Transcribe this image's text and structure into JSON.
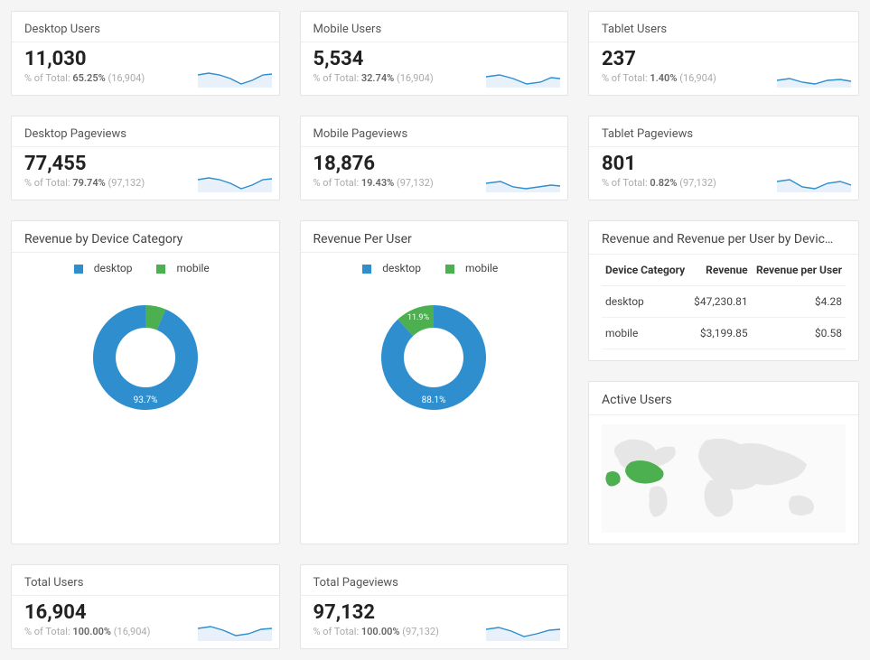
{
  "colors": {
    "blue": "#2e8ece",
    "green": "#4caf50",
    "spark_fill": "#e8f1fa",
    "spark_line": "#2e8ece",
    "map_land": "#e6e6e6",
    "map_highlight": "#4caf50",
    "map_bg": "#fafafa"
  },
  "scorecards": [
    {
      "title": "Desktop Users",
      "value": "11,030",
      "pct": "65.25%",
      "total": "(16,904)"
    },
    {
      "title": "Mobile Users",
      "value": "5,534",
      "pct": "32.74%",
      "total": "(16,904)"
    },
    {
      "title": "Tablet Users",
      "value": "237",
      "pct": "1.40%",
      "total": "(16,904)"
    },
    {
      "title": "Desktop Pageviews",
      "value": "77,455",
      "pct": "79.74%",
      "total": "(97,132)"
    },
    {
      "title": "Mobile Pageviews",
      "value": "18,876",
      "pct": "19.43%",
      "total": "(97,132)"
    },
    {
      "title": "Tablet Pageviews",
      "value": "801",
      "pct": "0.82%",
      "total": "(97,132)"
    }
  ],
  "totals": [
    {
      "title": "Total Users",
      "value": "16,904",
      "pct": "100.00%",
      "total": "(16,904)"
    },
    {
      "title": "Total Pageviews",
      "value": "97,132",
      "pct": "100.00%",
      "total": "(97,132)"
    }
  ],
  "donut1": {
    "title": "Revenue by Device Category",
    "legend": [
      "desktop",
      "mobile"
    ],
    "slices": [
      {
        "label": "desktop",
        "pct": 93.7,
        "color_key": "blue"
      },
      {
        "label": "mobile",
        "pct": 6.3,
        "color_key": "green"
      }
    ],
    "label_shown": "93.7%"
  },
  "donut2": {
    "title": "Revenue Per User",
    "legend": [
      "desktop",
      "mobile"
    ],
    "slices": [
      {
        "label": "desktop",
        "pct": 88.1,
        "color_key": "blue"
      },
      {
        "label": "mobile",
        "pct": 11.9,
        "color_key": "green"
      }
    ],
    "label_shown_primary": "88.1%",
    "label_shown_secondary": "11.9%"
  },
  "revenueTable": {
    "title": "Revenue and Revenue per User by Devic…",
    "headers": [
      "Device Category",
      "Revenue",
      "Revenue per User"
    ],
    "rows": [
      {
        "cat": "desktop",
        "revenue": "$47,230.81",
        "rpu": "$4.28"
      },
      {
        "cat": "mobile",
        "revenue": "$3,199.85",
        "rpu": "$0.58"
      }
    ]
  },
  "map": {
    "title": "Active Users"
  },
  "chart_data": [
    {
      "type": "bar",
      "title": "Desktop Users",
      "sublabel_prefix": "% of Total:",
      "values": [
        11030
      ],
      "total": 16904,
      "pct_of_total": 65.25
    },
    {
      "type": "bar",
      "title": "Mobile Users",
      "sublabel_prefix": "% of Total:",
      "values": [
        5534
      ],
      "total": 16904,
      "pct_of_total": 32.74
    },
    {
      "type": "bar",
      "title": "Tablet Users",
      "sublabel_prefix": "% of Total:",
      "values": [
        237
      ],
      "total": 16904,
      "pct_of_total": 1.4
    },
    {
      "type": "bar",
      "title": "Desktop Pageviews",
      "sublabel_prefix": "% of Total:",
      "values": [
        77455
      ],
      "total": 97132,
      "pct_of_total": 79.74
    },
    {
      "type": "bar",
      "title": "Mobile Pageviews",
      "sublabel_prefix": "% of Total:",
      "values": [
        18876
      ],
      "total": 97132,
      "pct_of_total": 19.43
    },
    {
      "type": "bar",
      "title": "Tablet Pageviews",
      "sublabel_prefix": "% of Total:",
      "values": [
        801
      ],
      "total": 97132,
      "pct_of_total": 0.82
    },
    {
      "type": "pie",
      "title": "Revenue by Device Category",
      "series": [
        {
          "name": "desktop",
          "value": 93.7
        },
        {
          "name": "mobile",
          "value": 6.3
        }
      ]
    },
    {
      "type": "pie",
      "title": "Revenue Per User",
      "series": [
        {
          "name": "desktop",
          "value": 88.1
        },
        {
          "name": "mobile",
          "value": 11.9
        }
      ]
    },
    {
      "type": "table",
      "title": "Revenue and Revenue per User by Device Category",
      "headers": [
        "Device Category",
        "Revenue",
        "Revenue per User"
      ],
      "rows": [
        [
          "desktop",
          47230.81,
          4.28
        ],
        [
          "mobile",
          3199.85,
          0.58
        ]
      ]
    },
    {
      "type": "bar",
      "title": "Total Users",
      "sublabel_prefix": "% of Total:",
      "values": [
        16904
      ],
      "total": 16904,
      "pct_of_total": 100.0
    },
    {
      "type": "bar",
      "title": "Total Pageviews",
      "sublabel_prefix": "% of Total:",
      "values": [
        97132
      ],
      "total": 97132,
      "pct_of_total": 100.0
    }
  ]
}
